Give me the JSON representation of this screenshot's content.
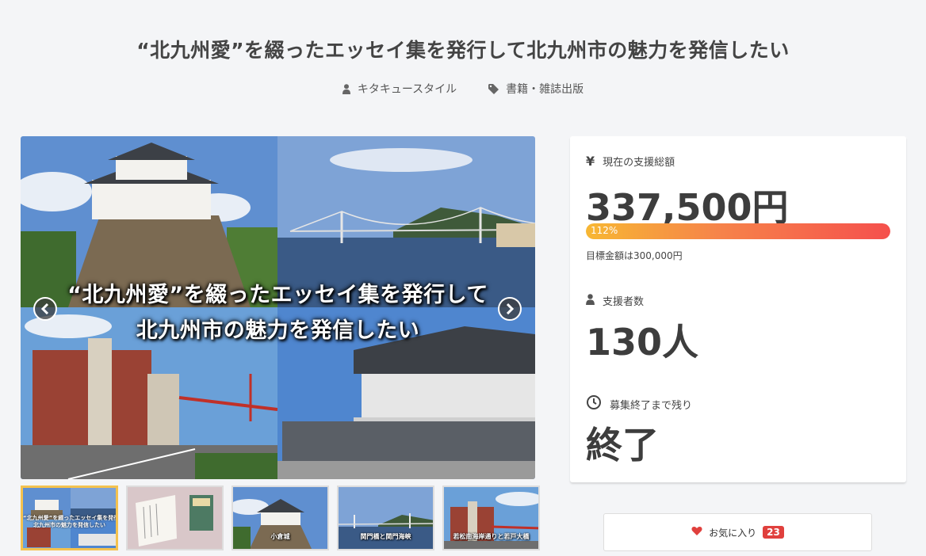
{
  "project": {
    "title": "“北九州愛”を綴ったエッセイ集を発行して北九州市の魅力を発信したい",
    "author": "キタキュースタイル",
    "category": "書籍・雑誌出版"
  },
  "hero": {
    "caption_line1": "“北九州愛”を綴ったエッセイ集を発行して",
    "caption_line2": "北九州市の魅力を発信したい"
  },
  "thumbnails": [
    {
      "label": "",
      "caption1": "“北九州愛”を綴ったエッセイ集を発行して",
      "caption2": "北九州市の魅力を発信したい"
    },
    {
      "label": "",
      "caption1": "",
      "caption2": ""
    },
    {
      "label": "小倉城",
      "caption1": "",
      "caption2": ""
    },
    {
      "label": "関門橋と関門海峡",
      "caption1": "",
      "caption2": ""
    },
    {
      "label": "若松南海岸通りと若戸大橋",
      "caption1": "",
      "caption2": ""
    }
  ],
  "stats": {
    "total_label": "現在の支援総額",
    "total_value": "337,500円",
    "progress_label": "112%",
    "progress_percent": 112,
    "goal_text": "目標金額は300,000円",
    "supporters_label": "支援者数",
    "supporters_value": "130人",
    "remaining_label": "募集終了まで残り",
    "remaining_value": "終了"
  },
  "favorite": {
    "label": "お気に入り",
    "count": "23"
  },
  "colors": {
    "accent": "#f5504c",
    "progress_start": "#f7b733",
    "thumb_active": "#f4c24e",
    "badge": "#e0403d"
  }
}
